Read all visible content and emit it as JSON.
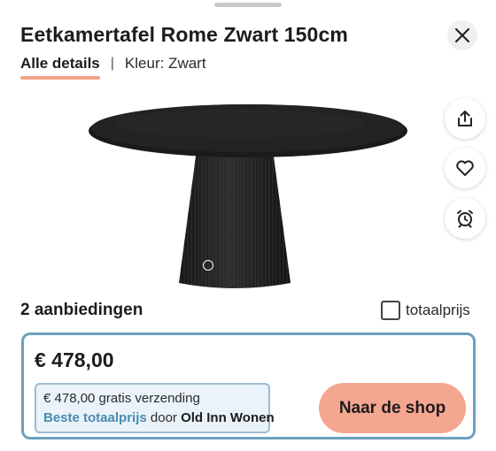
{
  "header": {
    "title": "Eetkamertafel Rome Zwart 150cm",
    "close_icon": "close-icon"
  },
  "tabs": {
    "details_label": "Alle details",
    "separator": "|",
    "color_label": "Kleur: Zwart"
  },
  "side_actions": {
    "share_icon": "share-icon",
    "favorite_icon": "heart-icon",
    "alert_icon": "alarm-clock-icon"
  },
  "offers": {
    "count_label": "2 aanbiedingen",
    "total_price_label": "totaalprijs",
    "total_price_checked": false
  },
  "offer": {
    "price": "€ 478,00",
    "shipping_text": "€ 478,00 gratis verzending",
    "best_label": "Beste totaalprijs",
    "by_text": "door",
    "shop_name": "Old Inn Wonen",
    "cta_label": "Naar de shop"
  },
  "colors": {
    "accent": "#f5a68f",
    "card_border": "#6d9fbf",
    "best_label": "#4a8bb0",
    "best_bg": "#eaf3f9"
  }
}
